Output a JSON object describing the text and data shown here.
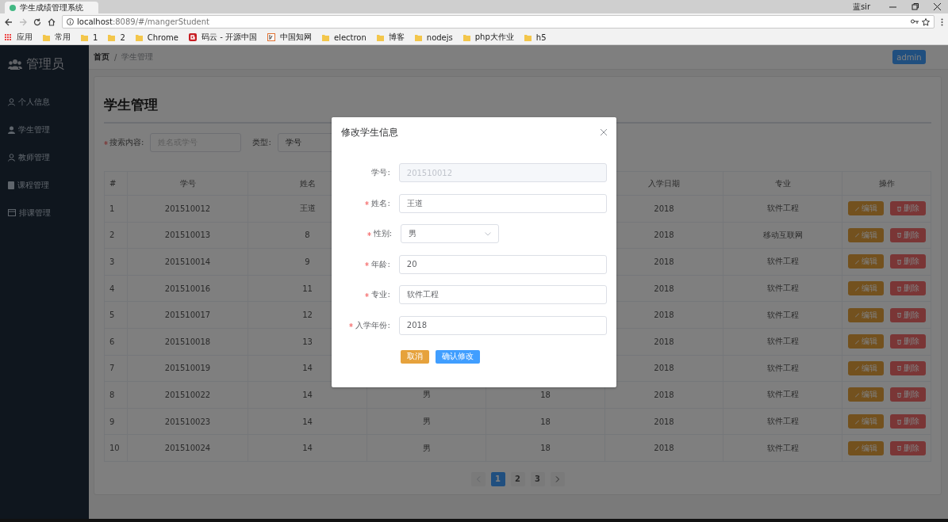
{
  "browser": {
    "tab_title": "学生成绩管理系统",
    "address_host": "localhost",
    "address_path": ":8089/#/mangerStudent",
    "user": "蓝sir",
    "bookmarks": [
      {
        "label": "应用",
        "kind": "apps"
      },
      {
        "label": "常用",
        "kind": "folder"
      },
      {
        "label": "1",
        "kind": "folder"
      },
      {
        "label": "2",
        "kind": "folder"
      },
      {
        "label": "Chrome",
        "kind": "folder"
      },
      {
        "label": "码云 - 开源中国",
        "kind": "gitee"
      },
      {
        "label": "中国知网",
        "kind": "cnki"
      },
      {
        "label": "electron",
        "kind": "folder"
      },
      {
        "label": "博客",
        "kind": "folder"
      },
      {
        "label": "nodejs",
        "kind": "folder"
      },
      {
        "label": "php大作业",
        "kind": "folder"
      },
      {
        "label": "h5",
        "kind": "folder"
      }
    ]
  },
  "sidebar": {
    "title": "管理员",
    "items": [
      {
        "label": "个人信息"
      },
      {
        "label": "学生管理"
      },
      {
        "label": "教师管理"
      },
      {
        "label": "课程管理"
      },
      {
        "label": "排课管理"
      }
    ]
  },
  "breadcrumb": {
    "items": [
      "首页",
      "学生管理"
    ],
    "separator": "/"
  },
  "user_button": "admin",
  "page_title": "学生管理",
  "search": {
    "label": "搜索内容:",
    "required": true,
    "placeholder": "姓名或学号",
    "type_label": "类型:",
    "type_value": "学号"
  },
  "table": {
    "columns": [
      "#",
      "学号",
      "姓名",
      null,
      null,
      "入学日期",
      "专业",
      "操作"
    ],
    "rows": [
      {
        "cells": [
          "1",
          "201510012",
          "王道",
          null,
          null,
          "2018",
          "软件工程"
        ],
        "actions": [
          "编辑",
          "删除"
        ]
      },
      {
        "cells": [
          "2",
          "201510013",
          "8",
          null,
          null,
          "2018",
          "移动互联网"
        ],
        "actions": [
          "编辑",
          "删除"
        ]
      },
      {
        "cells": [
          "3",
          "201510014",
          "9",
          null,
          null,
          "2018",
          "软件工程"
        ],
        "actions": [
          "编辑",
          "删除"
        ]
      },
      {
        "cells": [
          "4",
          "201510016",
          "11",
          null,
          null,
          "2018",
          "软件工程"
        ],
        "actions": [
          "编辑",
          "删除"
        ]
      },
      {
        "cells": [
          "5",
          "201510017",
          "12",
          null,
          null,
          "2018",
          "软件工程"
        ],
        "actions": [
          "编辑",
          "删除"
        ]
      },
      {
        "cells": [
          "6",
          "201510018",
          "13",
          null,
          null,
          "2018",
          "软件工程"
        ],
        "actions": [
          "编辑",
          "删除"
        ]
      },
      {
        "cells": [
          "7",
          "201510019",
          "14",
          null,
          null,
          "2018",
          "软件工程"
        ],
        "actions": [
          "编辑",
          "删除"
        ]
      },
      {
        "cells": [
          "8",
          "201510022",
          "14",
          "男",
          "18",
          "2018",
          "软件工程"
        ],
        "actions": [
          "编辑",
          "删除"
        ]
      },
      {
        "cells": [
          "9",
          "201510023",
          "14",
          "男",
          "18",
          "2018",
          "软件工程"
        ],
        "actions": [
          "编辑",
          "删除"
        ]
      },
      {
        "cells": [
          "10",
          "201510024",
          "14",
          "男",
          "18",
          "2018",
          "软件工程"
        ],
        "actions": [
          "编辑",
          "删除"
        ]
      }
    ]
  },
  "pagination": {
    "pages": [
      {
        "label": "1",
        "selected": true
      },
      {
        "label": "2",
        "selected": false
      },
      {
        "label": "3",
        "selected": false
      }
    ]
  },
  "dialog": {
    "title": "修改学生信息",
    "fields": [
      {
        "label": "学号:",
        "value": "201510012",
        "required": false,
        "disabled": true,
        "kind": "input"
      },
      {
        "label": "姓名:",
        "value": "王道",
        "required": true,
        "disabled": false,
        "kind": "input"
      },
      {
        "label": "性别:",
        "value": "男",
        "required": true,
        "disabled": false,
        "kind": "select"
      },
      {
        "label": "年龄:",
        "value": "20",
        "required": true,
        "disabled": false,
        "kind": "input"
      },
      {
        "label": "专业:",
        "value": "软件工程",
        "required": true,
        "disabled": false,
        "kind": "input"
      },
      {
        "label": "入学年份:",
        "value": "2018",
        "required": true,
        "disabled": false,
        "kind": "input"
      }
    ],
    "cancel": "取消",
    "confirm": "确认修改"
  }
}
